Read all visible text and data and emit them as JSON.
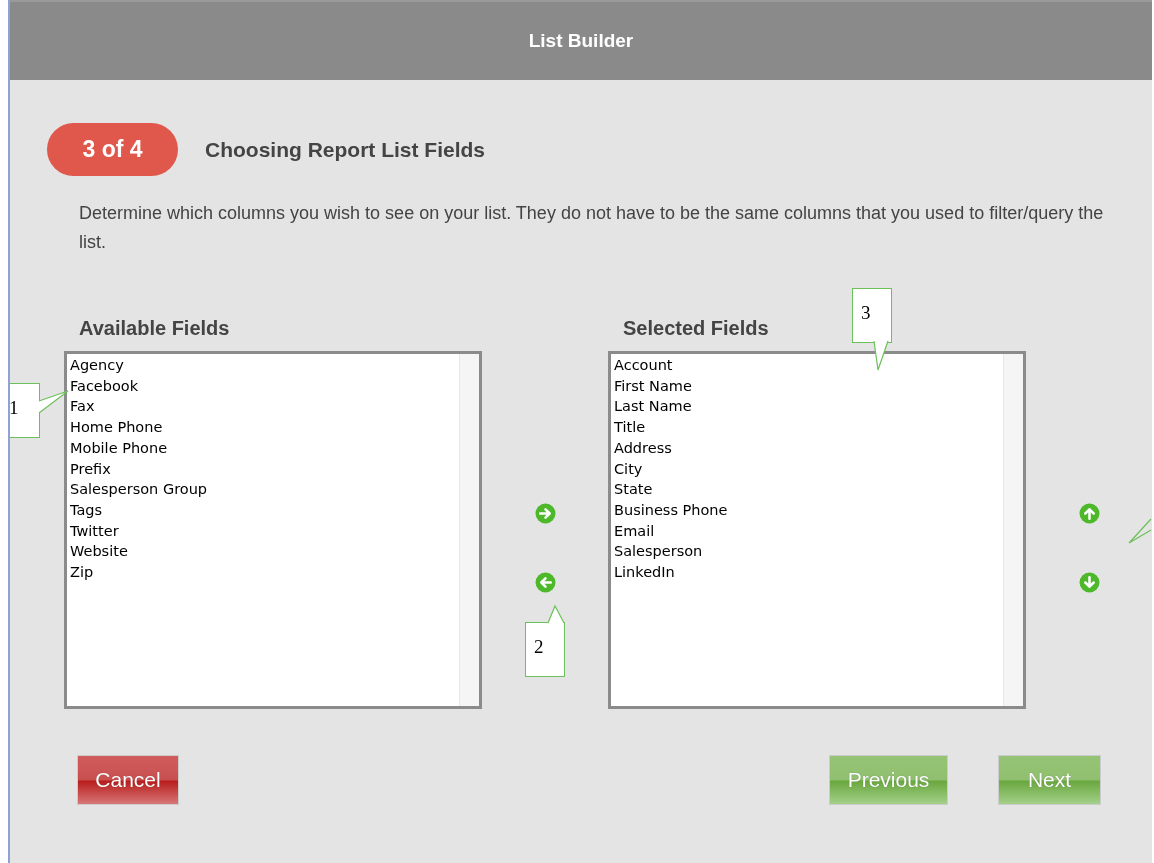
{
  "window": {
    "title": "List Builder"
  },
  "step": {
    "badge": "3 of 4",
    "title": "Choosing Report List Fields"
  },
  "description": "Determine which columns you wish to see on your list. They do not have to be the same columns that you used to filter/query the list.",
  "available": {
    "heading": "Available Fields",
    "items": [
      "Agency",
      "Facebook",
      "Fax",
      "Home Phone",
      "Mobile Phone",
      "Prefix",
      "Salesperson Group",
      "Tags",
      "Twitter",
      "Website",
      "Zip"
    ]
  },
  "selected": {
    "heading": "Selected Fields",
    "items": [
      "Account",
      "First Name",
      "Last Name",
      "Title",
      "Address",
      "City",
      "State",
      "Business Phone",
      "Email",
      "Salesperson",
      "LinkedIn"
    ]
  },
  "buttons": [
    {
      "label": "Cancel",
      "kind": "cancel"
    },
    {
      "label": "Previous",
      "kind": "nav"
    },
    {
      "label": "Next",
      "kind": "nav"
    }
  ],
  "callouts": [
    {
      "label": "1",
      "kind": "left"
    },
    {
      "label": "2",
      "kind": "up"
    },
    {
      "label": "3",
      "kind": "down"
    }
  ]
}
